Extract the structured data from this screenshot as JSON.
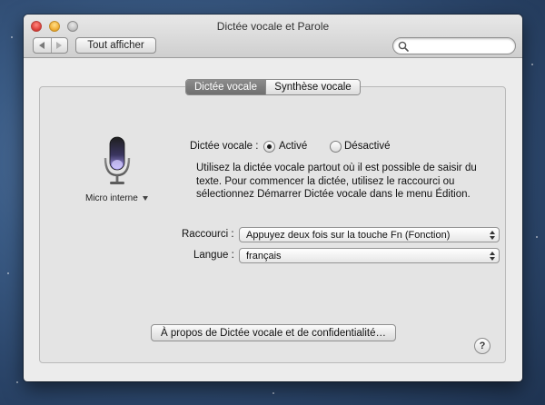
{
  "window": {
    "title": "Dictée vocale et Parole",
    "show_all_label": "Tout afficher",
    "search_placeholder": ""
  },
  "tabs": [
    {
      "label": "Dictée vocale",
      "active": true
    },
    {
      "label": "Synthèse vocale",
      "active": false
    }
  ],
  "mic": {
    "label": "Micro interne"
  },
  "dictation": {
    "label": "Dictée vocale :",
    "options": [
      {
        "label": "Activé",
        "selected": true
      },
      {
        "label": "Désactivé",
        "selected": false
      }
    ],
    "description": "Utilisez la dictée vocale partout où il est possible de saisir du texte. Pour commencer la dictée, utilisez le raccourci ou sélectionnez Démarrer Dictée vocale dans le menu Édition."
  },
  "shortcut": {
    "label": "Raccourci :",
    "value": "Appuyez deux fois sur la touche Fn (Fonction)"
  },
  "language": {
    "label": "Langue :",
    "value": "français"
  },
  "about_button": "À propos de Dictée vocale et de confidentialité…",
  "help_glyph": "?",
  "colors": {
    "active_tab": "#7d7d7d",
    "mic_glow": "#9b8cf0"
  }
}
